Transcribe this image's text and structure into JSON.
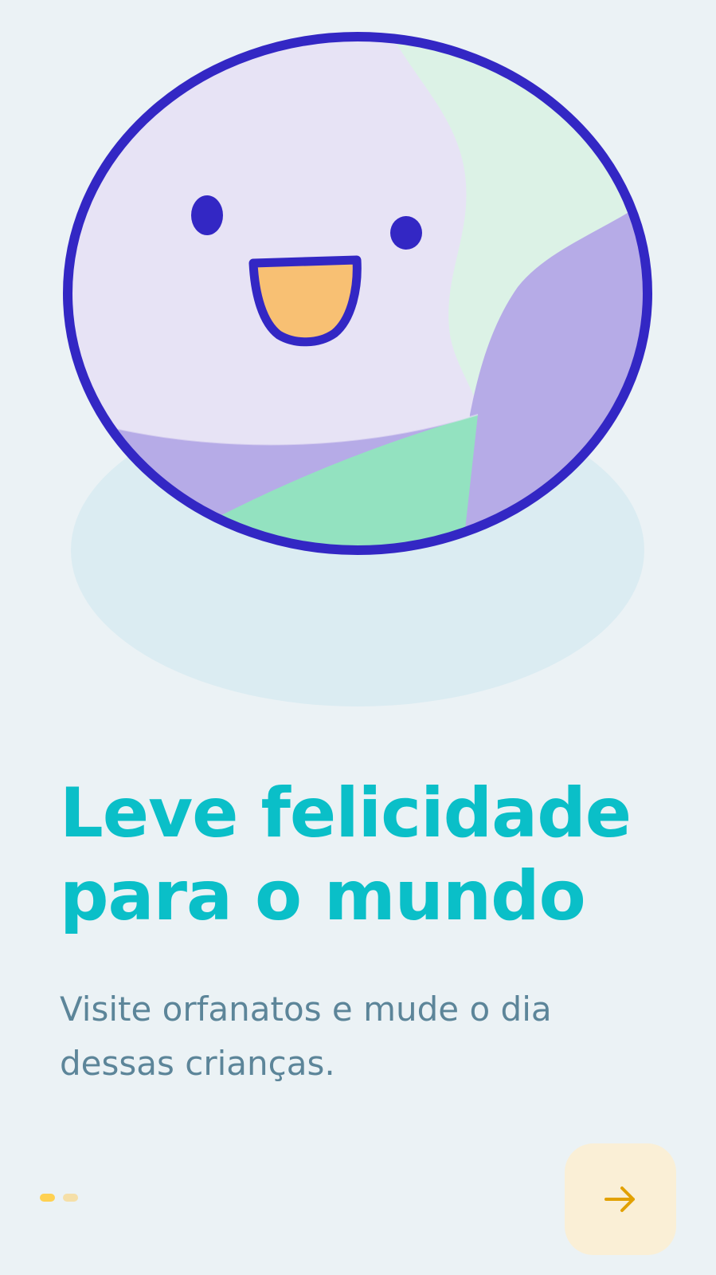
{
  "onboarding": {
    "title": "Leve felicidade\npara o mundo",
    "subtitle": "Visite orfanatos e mude o dia\ndessas crianças."
  },
  "pager": {
    "pages": 2,
    "current_page": 1
  },
  "next_button": {
    "icon": "arrow-right-icon"
  },
  "colors": {
    "background": "#EBF2F5",
    "title": "#0ABFC8",
    "subtitle": "#5C8599",
    "accent_yellow": "#FFD152",
    "button_bg": "#FAEFD6",
    "arrow": "#E2A100",
    "globe_outline": "#3327C4"
  }
}
